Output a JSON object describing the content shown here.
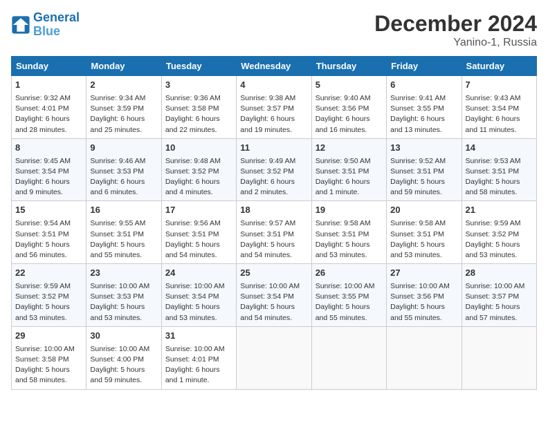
{
  "header": {
    "logo_line1": "General",
    "logo_line2": "Blue",
    "month": "December 2024",
    "location": "Yanino-1, Russia"
  },
  "days_of_week": [
    "Sunday",
    "Monday",
    "Tuesday",
    "Wednesday",
    "Thursday",
    "Friday",
    "Saturday"
  ],
  "weeks": [
    [
      {
        "day": "1",
        "info": "Sunrise: 9:32 AM\nSunset: 4:01 PM\nDaylight: 6 hours\nand 28 minutes."
      },
      {
        "day": "2",
        "info": "Sunrise: 9:34 AM\nSunset: 3:59 PM\nDaylight: 6 hours\nand 25 minutes."
      },
      {
        "day": "3",
        "info": "Sunrise: 9:36 AM\nSunset: 3:58 PM\nDaylight: 6 hours\nand 22 minutes."
      },
      {
        "day": "4",
        "info": "Sunrise: 9:38 AM\nSunset: 3:57 PM\nDaylight: 6 hours\nand 19 minutes."
      },
      {
        "day": "5",
        "info": "Sunrise: 9:40 AM\nSunset: 3:56 PM\nDaylight: 6 hours\nand 16 minutes."
      },
      {
        "day": "6",
        "info": "Sunrise: 9:41 AM\nSunset: 3:55 PM\nDaylight: 6 hours\nand 13 minutes."
      },
      {
        "day": "7",
        "info": "Sunrise: 9:43 AM\nSunset: 3:54 PM\nDaylight: 6 hours\nand 11 minutes."
      }
    ],
    [
      {
        "day": "8",
        "info": "Sunrise: 9:45 AM\nSunset: 3:54 PM\nDaylight: 6 hours\nand 9 minutes."
      },
      {
        "day": "9",
        "info": "Sunrise: 9:46 AM\nSunset: 3:53 PM\nDaylight: 6 hours\nand 6 minutes."
      },
      {
        "day": "10",
        "info": "Sunrise: 9:48 AM\nSunset: 3:52 PM\nDaylight: 6 hours\nand 4 minutes."
      },
      {
        "day": "11",
        "info": "Sunrise: 9:49 AM\nSunset: 3:52 PM\nDaylight: 6 hours\nand 2 minutes."
      },
      {
        "day": "12",
        "info": "Sunrise: 9:50 AM\nSunset: 3:51 PM\nDaylight: 6 hours\nand 1 minute."
      },
      {
        "day": "13",
        "info": "Sunrise: 9:52 AM\nSunset: 3:51 PM\nDaylight: 5 hours\nand 59 minutes."
      },
      {
        "day": "14",
        "info": "Sunrise: 9:53 AM\nSunset: 3:51 PM\nDaylight: 5 hours\nand 58 minutes."
      }
    ],
    [
      {
        "day": "15",
        "info": "Sunrise: 9:54 AM\nSunset: 3:51 PM\nDaylight: 5 hours\nand 56 minutes."
      },
      {
        "day": "16",
        "info": "Sunrise: 9:55 AM\nSunset: 3:51 PM\nDaylight: 5 hours\nand 55 minutes."
      },
      {
        "day": "17",
        "info": "Sunrise: 9:56 AM\nSunset: 3:51 PM\nDaylight: 5 hours\nand 54 minutes."
      },
      {
        "day": "18",
        "info": "Sunrise: 9:57 AM\nSunset: 3:51 PM\nDaylight: 5 hours\nand 54 minutes."
      },
      {
        "day": "19",
        "info": "Sunrise: 9:58 AM\nSunset: 3:51 PM\nDaylight: 5 hours\nand 53 minutes."
      },
      {
        "day": "20",
        "info": "Sunrise: 9:58 AM\nSunset: 3:51 PM\nDaylight: 5 hours\nand 53 minutes."
      },
      {
        "day": "21",
        "info": "Sunrise: 9:59 AM\nSunset: 3:52 PM\nDaylight: 5 hours\nand 53 minutes."
      }
    ],
    [
      {
        "day": "22",
        "info": "Sunrise: 9:59 AM\nSunset: 3:52 PM\nDaylight: 5 hours\nand 53 minutes."
      },
      {
        "day": "23",
        "info": "Sunrise: 10:00 AM\nSunset: 3:53 PM\nDaylight: 5 hours\nand 53 minutes."
      },
      {
        "day": "24",
        "info": "Sunrise: 10:00 AM\nSunset: 3:54 PM\nDaylight: 5 hours\nand 53 minutes."
      },
      {
        "day": "25",
        "info": "Sunrise: 10:00 AM\nSunset: 3:54 PM\nDaylight: 5 hours\nand 54 minutes."
      },
      {
        "day": "26",
        "info": "Sunrise: 10:00 AM\nSunset: 3:55 PM\nDaylight: 5 hours\nand 55 minutes."
      },
      {
        "day": "27",
        "info": "Sunrise: 10:00 AM\nSunset: 3:56 PM\nDaylight: 5 hours\nand 55 minutes."
      },
      {
        "day": "28",
        "info": "Sunrise: 10:00 AM\nSunset: 3:57 PM\nDaylight: 5 hours\nand 57 minutes."
      }
    ],
    [
      {
        "day": "29",
        "info": "Sunrise: 10:00 AM\nSunset: 3:58 PM\nDaylight: 5 hours\nand 58 minutes."
      },
      {
        "day": "30",
        "info": "Sunrise: 10:00 AM\nSunset: 4:00 PM\nDaylight: 5 hours\nand 59 minutes."
      },
      {
        "day": "31",
        "info": "Sunrise: 10:00 AM\nSunset: 4:01 PM\nDaylight: 6 hours\nand 1 minute."
      },
      {
        "day": "",
        "info": ""
      },
      {
        "day": "",
        "info": ""
      },
      {
        "day": "",
        "info": ""
      },
      {
        "day": "",
        "info": ""
      }
    ]
  ]
}
